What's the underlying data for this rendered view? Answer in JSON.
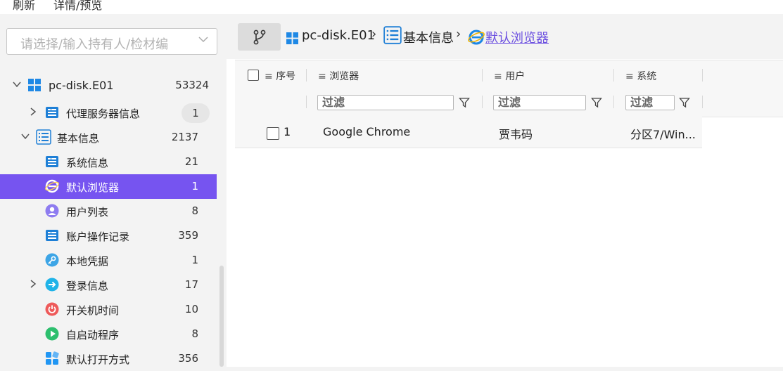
{
  "top_menu": {
    "refresh": "刷新",
    "details": "详情/预览"
  },
  "search": {
    "placeholder": "请选择/输入持有人/检材编"
  },
  "tree": {
    "root": {
      "label": "pc-disk.E01",
      "count": "53324"
    },
    "items": [
      {
        "label": "代理服务器信息",
        "count": "1"
      },
      {
        "label": "基本信息",
        "count": "2137"
      },
      {
        "label": "系统信息",
        "count": "21"
      },
      {
        "label": "默认浏览器",
        "count": "1"
      },
      {
        "label": "用户列表",
        "count": "8"
      },
      {
        "label": "账户操作记录",
        "count": "359"
      },
      {
        "label": "本地凭据",
        "count": "1"
      },
      {
        "label": "登录信息",
        "count": "17"
      },
      {
        "label": "开关机时间",
        "count": "10"
      },
      {
        "label": "自启动程序",
        "count": "8"
      },
      {
        "label": "默认打开方式",
        "count": "356"
      }
    ]
  },
  "breadcrumb": {
    "disk": "pc-disk.E01",
    "category": "基本信息",
    "current": "默认浏览器",
    "sep": "›"
  },
  "grid": {
    "columns": [
      "序号",
      "浏览器",
      "用户",
      "系统"
    ],
    "filter_placeholder": "过滤",
    "rows": [
      {
        "index": "1",
        "browser": "Google Chrome",
        "user": "贾韦码",
        "system": "分区7/Win..."
      }
    ]
  },
  "colors": {
    "accent": "#7654f0",
    "windows_blue": "#1e88e5",
    "link": "#6b4fe0"
  }
}
